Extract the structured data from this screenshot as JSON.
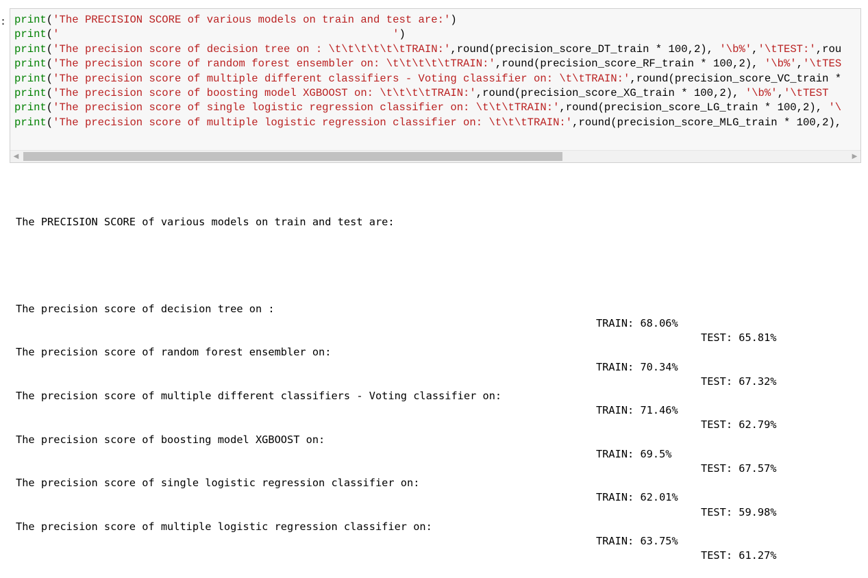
{
  "prompt": ":",
  "code_lines": [
    {
      "fn": "print",
      "args": "('The PRECISION SCORE of various models on train and test are:')"
    },
    {
      "fn": "print",
      "args": "('                                                    ')"
    },
    {
      "fn": "print",
      "args": "('The precision score of decision tree on : \\t\\t\\t\\t\\t\\tTRAIN:',round(precision_score_DT_train * 100,2), '\\b%','\\tTEST:',rou"
    },
    {
      "fn": "print",
      "args": "('The precision score of random forest ensembler on: \\t\\t\\t\\t\\tTRAIN:',round(precision_score_RF_train * 100,2), '\\b%','\\tTES"
    },
    {
      "fn": "print",
      "args": "('The precision score of multiple different classifiers - Voting classifier on: \\t\\tTRAIN:',round(precision_score_VC_train *"
    },
    {
      "fn": "print",
      "args": "('The precision score of boosting model XGBOOST on: \\t\\t\\t\\tTRAIN:',round(precision_score_XG_train * 100,2), '\\b%','\\tTEST"
    },
    {
      "fn": "print",
      "args": "('The precision score of single logistic regression classifier on: \\t\\t\\tTRAIN:',round(precision_score_LG_train * 100,2), '\\"
    },
    {
      "fn": "print",
      "args": "('The precision score of multiple logistic regression classifier on: \\t\\t\\tTRAIN:',round(precision_score_MLG_train * 100,2),"
    }
  ],
  "output": {
    "header": "The PRECISION SCORE of various models on train and test are:",
    "rows": [
      {
        "label": "The precision score of decision tree on :",
        "train": "TRAIN: 68.06%",
        "test": "TEST: 65.81%"
      },
      {
        "label": "The precision score of random forest ensembler on:",
        "train": "TRAIN: 70.34%",
        "test": "TEST: 67.32%"
      },
      {
        "label": "The precision score of multiple different classifiers - Voting classifier on:",
        "train": "TRAIN: 71.46%",
        "test": "TEST: 62.79%"
      },
      {
        "label": "The precision score of boosting model XGBOOST on:",
        "train": "TRAIN: 69.5%",
        "test": "TEST: 67.57%"
      },
      {
        "label": "The precision score of single logistic regression classifier on:",
        "train": "TRAIN: 62.01%",
        "test": "TEST: 59.98%"
      },
      {
        "label": "The precision score of multiple logistic regression classifier on:",
        "train": "TRAIN: 63.75%",
        "test": "TEST: 61.27%"
      }
    ]
  },
  "scrollbar": {
    "left_arrow_icon": "chevron-left-icon",
    "right_arrow_icon": "chevron-right-icon"
  },
  "colors": {
    "keyword": "#008000",
    "string": "#ba2121",
    "cell_background": "#f7f7f7"
  }
}
